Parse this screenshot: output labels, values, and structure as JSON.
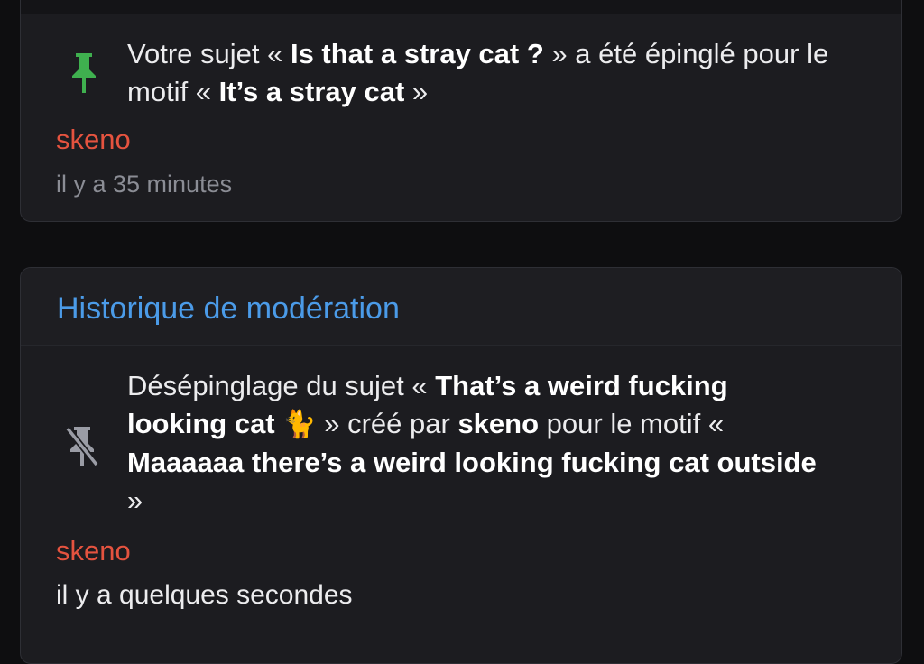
{
  "entries": [
    {
      "icon": "pin-icon",
      "icon_color": "#3fb04f",
      "text": {
        "p1": "Votre sujet « ",
        "b1": "Is that a stray cat ?",
        "p2": " » a été épinglé pour le motif « ",
        "b2": "It’s a stray cat",
        "p3": " »"
      },
      "author": "skeno",
      "time": "il y a 35 minutes"
    }
  ],
  "moderation_history": {
    "title": "Historique de modération",
    "entry": {
      "icon": "unpin-icon",
      "icon_color": "#9a9ca5",
      "text": {
        "p1": "Désépinglage du sujet « ",
        "b1": "That’s a weird fucking looking cat",
        "emoji": "🐈",
        "p2": " » créé par ",
        "b2": "skeno",
        "p3": " pour le motif « ",
        "b3": "Maaaaaa there’s a weird looking fucking cat outside",
        "p4": " »"
      },
      "author": "skeno",
      "time": "il y a quelques secondes"
    }
  },
  "colors": {
    "accent_blue": "#4b9be8",
    "author_red": "#e5533f",
    "pin_green": "#3fb04f",
    "background": "#0e0e10",
    "card": "#1c1c20"
  }
}
